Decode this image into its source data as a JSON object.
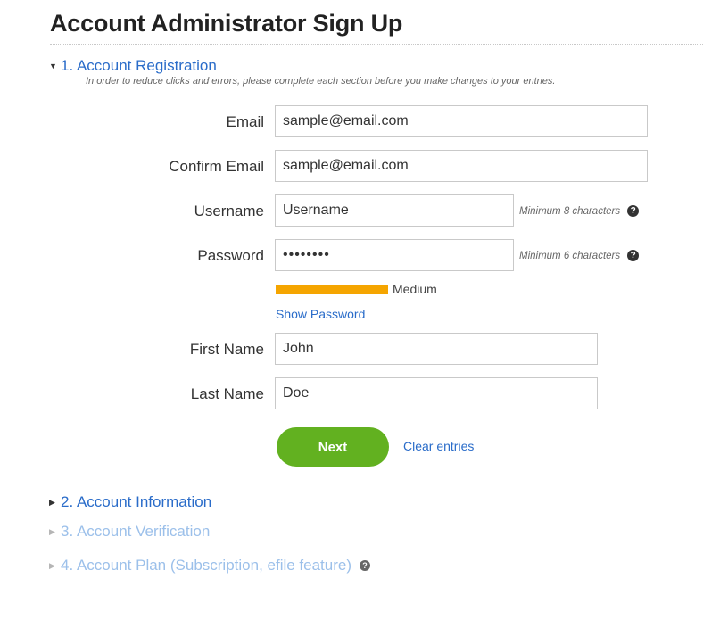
{
  "page": {
    "title": "Account Administrator Sign Up"
  },
  "sections": [
    {
      "number_label": "1. Account Registration",
      "state": "expanded"
    },
    {
      "number_label": "2. Account Information",
      "state": "collapsed"
    },
    {
      "number_label": "3. Account Verification",
      "state": "disabled"
    },
    {
      "number_label": "4. Account Plan (Subscription, efile feature)",
      "state": "disabled"
    }
  ],
  "registration": {
    "instructions": "In order to reduce clicks and errors, please complete each section before you make changes to your entries.",
    "email": {
      "label": "Email",
      "value": "sample@email.com"
    },
    "confirm_email": {
      "label": "Confirm Email",
      "value": "sample@email.com"
    },
    "username": {
      "label": "Username",
      "value": "Username",
      "hint": "Minimum 8 characters"
    },
    "password": {
      "label": "Password",
      "value": "••••••••",
      "hint": "Minimum 6 characters"
    },
    "strength": {
      "label": "Medium",
      "level": 0.55,
      "color": "#f5a500"
    },
    "show_password_label": "Show Password",
    "first_name": {
      "label": "First Name",
      "value": "John"
    },
    "last_name": {
      "label": "Last Name",
      "value": "Doe"
    },
    "next_label": "Next",
    "clear_label": "Clear entries"
  },
  "icons": {
    "expanded_arrow": "▼",
    "collapsed_arrow": "▶",
    "help": "?"
  },
  "colors": {
    "link": "#2a6cc9",
    "link_disabled": "#9cc0ea",
    "primary_button": "#62b120",
    "strength_medium": "#f5a500"
  }
}
